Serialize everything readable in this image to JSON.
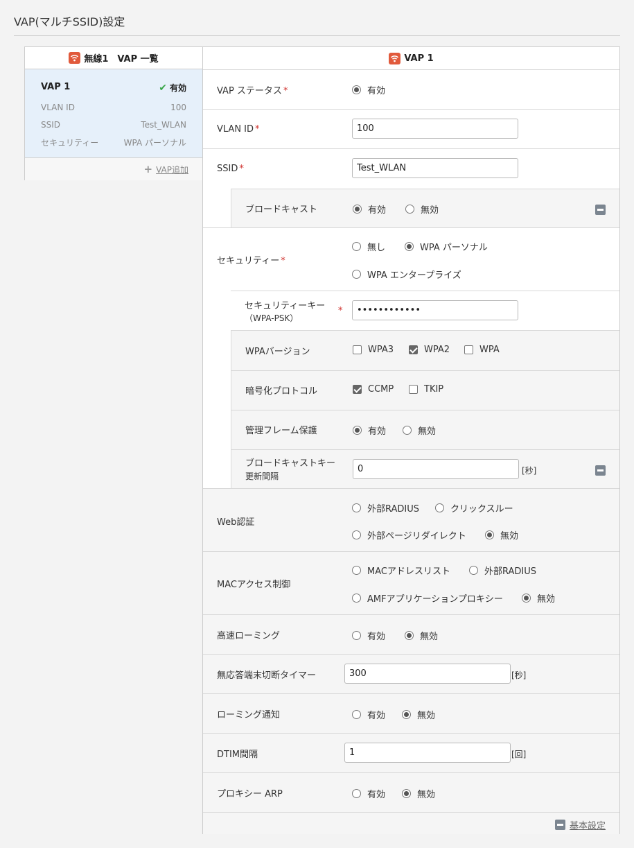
{
  "page": {
    "title": "VAP(マルチSSID)設定"
  },
  "colors": {
    "accent": "#e15a3c",
    "selected_card": "#e6f0fa",
    "check": "#3aa64a",
    "required": "#d0312d"
  },
  "left_panel": {
    "header": "無線1　VAP 一覧",
    "header_icon": "wifi-icon",
    "card": {
      "name": "VAP 1",
      "status": "有効",
      "status_icon": "check-icon",
      "rows": [
        {
          "label": "VLAN ID",
          "value": "100"
        },
        {
          "label": "SSID",
          "value": "Test_WLAN"
        },
        {
          "label": "セキュリティー",
          "value": "WPA パーソナル"
        }
      ]
    },
    "add_link": "VAP追加",
    "add_icon": "plus-icon"
  },
  "right_panel": {
    "header": "VAP 1",
    "required_mark": "*",
    "vap_status": {
      "label": "VAP ステータス",
      "option": "有効",
      "selected": true
    },
    "vlan_id": {
      "label": "VLAN ID",
      "value": "100"
    },
    "ssid": {
      "label": "SSID",
      "value": "Test_WLAN"
    },
    "broadcast": {
      "label": "ブロードキャスト",
      "options": [
        "有効",
        "無効"
      ],
      "selected": "有効"
    },
    "security": {
      "label": "セキュリティー",
      "options": [
        "無し",
        "WPA パーソナル",
        "WPA エンタープライズ"
      ],
      "selected": "WPA パーソナル",
      "key_label_1": "セキュリティーキー",
      "key_label_2": "（WPA-PSK）",
      "key_value": "••••••••••••",
      "wpa_version": {
        "label": "WPAバージョン",
        "options": [
          "WPA3",
          "WPA2",
          "WPA"
        ],
        "checked": [
          "WPA2"
        ]
      },
      "encryption": {
        "label": "暗号化プロトコル",
        "options": [
          "CCMP",
          "TKIP"
        ],
        "checked": [
          "CCMP"
        ]
      },
      "mgmt_frame": {
        "label": "管理フレーム保護",
        "options": [
          "有効",
          "無効"
        ],
        "selected": "有効"
      },
      "bcast_key": {
        "label_1": "ブロードキャストキー",
        "label_2": "更新間隔",
        "value": "0",
        "unit": "[秒]"
      }
    },
    "web_auth": {
      "label": "Web認証",
      "options": [
        "外部RADIUS",
        "クリックスルー",
        "外部ページリダイレクト",
        "無効"
      ],
      "selected": "無効"
    },
    "mac_access": {
      "label": "MACアクセス制御",
      "options": [
        "MACアドレスリスト",
        "外部RADIUS",
        "AMFアプリケーションプロキシー",
        "無効"
      ],
      "selected": "無効"
    },
    "fast_roaming": {
      "label": "高速ローミング",
      "options": [
        "有効",
        "無効"
      ],
      "selected": "無効"
    },
    "no_response_timer": {
      "label": "無応答端末切断タイマー",
      "value": "300",
      "unit": "[秒]"
    },
    "roaming_notice": {
      "label": "ローミング通知",
      "options": [
        "有効",
        "無効"
      ],
      "selected": "無効"
    },
    "dtim": {
      "label": "DTIM間隔",
      "value": "1",
      "unit": "[回]"
    },
    "proxy_arp": {
      "label": "プロキシー ARP",
      "options": [
        "有効",
        "無効"
      ],
      "selected": "無効"
    },
    "footer_link": "基本設定"
  }
}
